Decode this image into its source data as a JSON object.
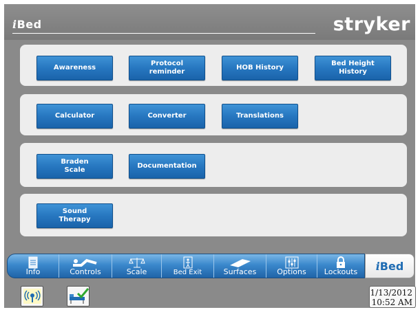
{
  "header": {
    "app_title_prefix": "i",
    "app_title_rest": "Bed",
    "brand": "stryker"
  },
  "groups": [
    {
      "buttons": [
        {
          "label": "Awareness"
        },
        {
          "label": "Protocol\nreminder"
        },
        {
          "label": "HOB History"
        },
        {
          "label": "Bed Height\nHistory"
        }
      ]
    },
    {
      "buttons": [
        {
          "label": "Calculator"
        },
        {
          "label": "Converter"
        },
        {
          "label": "Translations"
        }
      ]
    },
    {
      "buttons": [
        {
          "label": "Braden\nScale"
        },
        {
          "label": "Documentation"
        }
      ]
    },
    {
      "buttons": [
        {
          "label": "Sound\nTherapy"
        }
      ]
    }
  ],
  "tabs": [
    {
      "label": "Info",
      "icon": "info-icon"
    },
    {
      "label": "Controls",
      "icon": "bed-controls-icon"
    },
    {
      "label": "Scale",
      "icon": "scale-icon"
    },
    {
      "label": "Bed Exit",
      "icon": "bed-exit-icon"
    },
    {
      "label": "Surfaces",
      "icon": "surface-icon"
    },
    {
      "label": "Options",
      "icon": "options-sliders-icon"
    },
    {
      "label": "Lockouts",
      "icon": "lock-icon"
    }
  ],
  "active_tab": {
    "prefix": "i",
    "label": "Bed"
  },
  "status": {
    "wireless_icon": "wireless-icon",
    "bed_ok_icon": "bed-ok-icon"
  },
  "datetime": {
    "date": "1/13/2012",
    "time": "10:52 AM"
  },
  "colors": {
    "button_blue": "#2777c0",
    "tab_blue": "#3b88cc",
    "panel_gray": "#8a8a8a",
    "group_bg": "#ededed"
  }
}
